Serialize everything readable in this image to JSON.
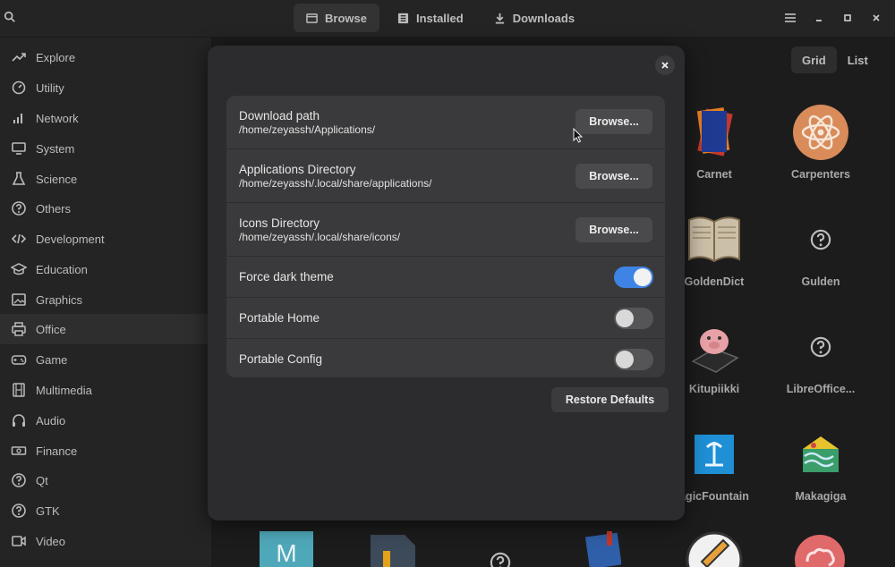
{
  "header": {
    "tabs": [
      {
        "label": "Browse",
        "icon": "browse-icon",
        "active": true
      },
      {
        "label": "Installed",
        "icon": "installed-icon",
        "active": false
      },
      {
        "label": "Downloads",
        "icon": "download-icon",
        "active": false
      }
    ]
  },
  "sidebar": {
    "items": [
      {
        "label": "Explore",
        "icon": "trending-icon"
      },
      {
        "label": "Utility",
        "icon": "gauge-icon"
      },
      {
        "label": "Network",
        "icon": "signal-icon"
      },
      {
        "label": "System",
        "icon": "monitor-icon"
      },
      {
        "label": "Science",
        "icon": "flask-icon"
      },
      {
        "label": "Others",
        "icon": "question-icon"
      },
      {
        "label": "Development",
        "icon": "code-icon"
      },
      {
        "label": "Education",
        "icon": "graduation-cap-icon"
      },
      {
        "label": "Graphics",
        "icon": "image-icon"
      },
      {
        "label": "Office",
        "icon": "printer-icon",
        "active": true
      },
      {
        "label": "Game",
        "icon": "gamepad-icon"
      },
      {
        "label": "Multimedia",
        "icon": "film-icon"
      },
      {
        "label": "Audio",
        "icon": "headphones-icon"
      },
      {
        "label": "Finance",
        "icon": "money-icon"
      },
      {
        "label": "Qt",
        "icon": "question-icon"
      },
      {
        "label": "GTK",
        "icon": "question-icon"
      },
      {
        "label": "Video",
        "icon": "video-icon"
      }
    ]
  },
  "view_toggle": {
    "grid_label": "Grid",
    "list_label": "List",
    "active": "Grid"
  },
  "apps": [
    {
      "label": "Carnet"
    },
    {
      "label": "Carpenters"
    },
    {
      "label": "GoldenDict"
    },
    {
      "label": "Gulden"
    },
    {
      "label": "Kitupiikki"
    },
    {
      "label": "LibreOffice..."
    },
    {
      "label": "agicFountain"
    },
    {
      "label": "Makagiga"
    }
  ],
  "dialog": {
    "rows": [
      {
        "title": "Download path",
        "subtitle": "/home/zeyassh/Applications/",
        "button": "Browse..."
      },
      {
        "title": "Applications Directory",
        "subtitle": "/home/zeyassh/.local/share/applications/",
        "button": "Browse..."
      },
      {
        "title": "Icons Directory",
        "subtitle": "/home/zeyassh/.local/share/icons/",
        "button": "Browse..."
      }
    ],
    "toggles": [
      {
        "title": "Force dark theme",
        "on": true
      },
      {
        "title": "Portable Home",
        "on": false
      },
      {
        "title": "Portable Config",
        "on": false
      }
    ],
    "restore_label": "Restore Defaults"
  },
  "colors": {
    "accent": "#3f84e4",
    "dialog_bg": "#2c2c2e",
    "list_bg": "#3a3a3c",
    "window_bg": "#1c1c1c"
  }
}
